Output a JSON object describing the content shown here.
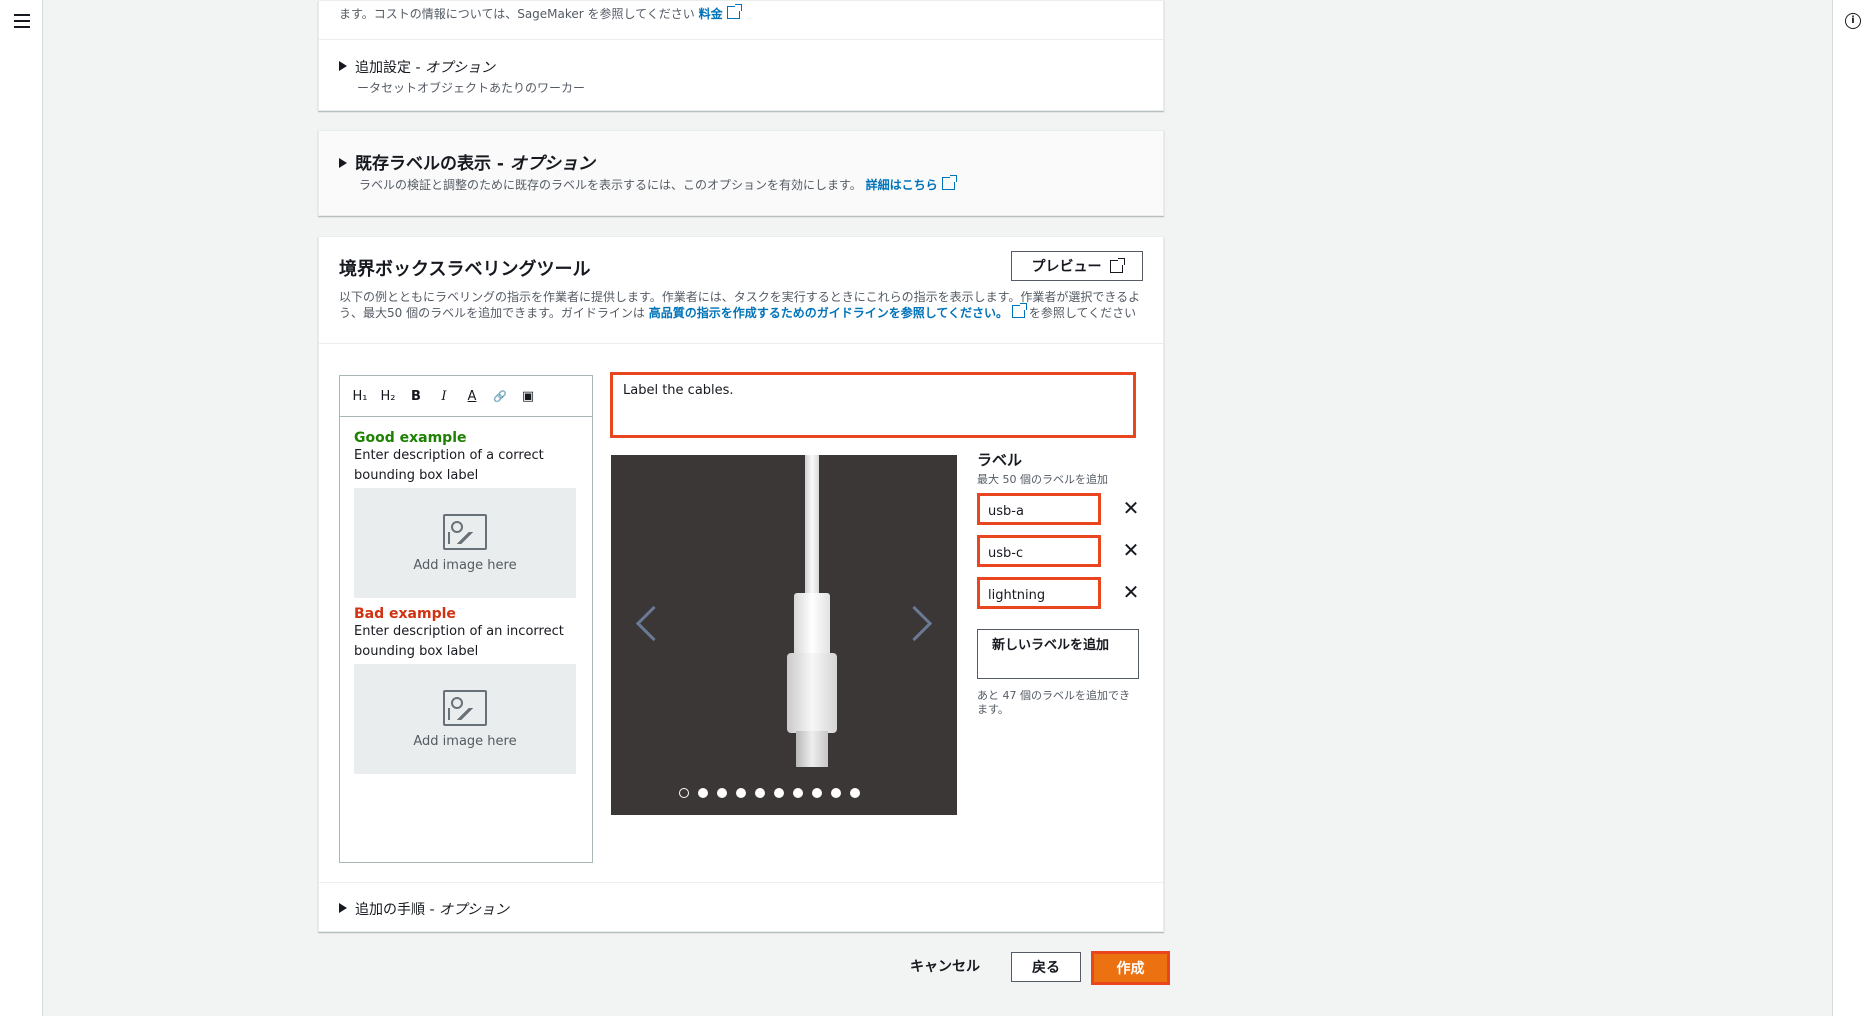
{
  "top_panel": {
    "cost_text": "ます。コストの情報については、SageMaker を参照してください",
    "cost_link": "料金",
    "additional_settings_title": "追加設定 - ",
    "additional_settings_optional": "オプション",
    "additional_settings_sub": "ータセットオブジェクトあたりのワーカー"
  },
  "existing_labels": {
    "title": "既存ラベルの表示 - ",
    "optional": "オプション",
    "description": "ラベルの検証と調整のために既存のラベルを表示するには、このオプションを有効にします。",
    "link": "詳細はこちら"
  },
  "tool": {
    "title": "境界ボックスラベリングツール",
    "preview_label": "プレビュー",
    "description_1": "以下の例とともにラベリングの指示を作業者に提供します。作業者には、タスクを実行するときにこれらの指示を表示します。作業者が選択できるよう、最大50 個のラベルを追加できます。ガイドラインは ",
    "description_link": "高品質の指示を作成するためのガイドラインを参照してください。",
    "description_2": "を参照してください"
  },
  "editor": {
    "toolbar": [
      "H₁",
      "H₂",
      "B",
      "I",
      "A",
      "🔗",
      "▣"
    ],
    "good_title": "Good example",
    "good_desc": "Enter description of a correct bounding box label",
    "bad_title": "Bad example",
    "bad_desc": "Enter description of an incorrect bounding box label",
    "image_placeholder": "Add image here"
  },
  "instructions_value": "Label the cables.",
  "labels_panel": {
    "title": "ラベル",
    "subtitle": "最大 50 個のラベルを追加",
    "items": [
      "usb-a",
      "usb-c",
      "lightning"
    ],
    "add_button": "新しいラベルを追加",
    "remaining": "あと 47 個のラベルを追加できます。"
  },
  "carousel": {
    "dot_count": 10,
    "active_index": 0
  },
  "additional_steps": {
    "title": "追加の手順 - ",
    "optional": "オプション"
  },
  "footer": {
    "cancel": "キャンセル",
    "back": "戻る",
    "create": "作成"
  },
  "colors": {
    "highlight": "#e8461f",
    "primary": "#ec7211",
    "link": "#0073bb",
    "good": "#1d8102",
    "bad": "#d13212"
  }
}
